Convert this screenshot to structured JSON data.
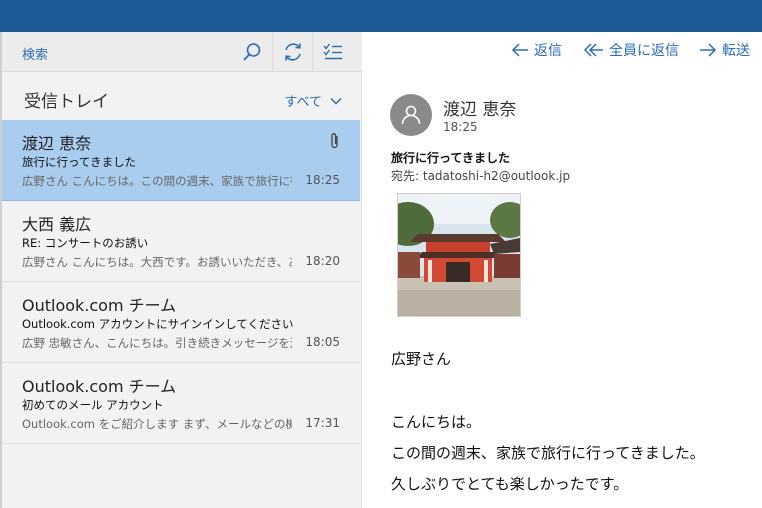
{
  "search": {
    "label": "検索"
  },
  "folder": {
    "name": "受信トレイ",
    "filter": "すべて"
  },
  "messages": [
    {
      "sender": "渡辺 恵奈",
      "subject": "旅行に行ってきました",
      "preview": "広野さん こんにちは。この間の週末、家族で旅行に行ってきました。",
      "time": "18:25"
    },
    {
      "sender": "大西 義広",
      "subject": "RE: コンサートのお誘い",
      "preview": "広野さん こんにちは。大西です。お誘いいただき、ありがとうございます。",
      "time": "18:20"
    },
    {
      "sender": "Outlook.com チーム",
      "subject": "Outlook.com アカウントにサインインしてください",
      "preview": "広野 忠敏さん、こんにちは。引き続きメッセージを送信するには",
      "time": "18:05"
    },
    {
      "sender": "Outlook.com チーム",
      "subject": "初めてのメール アカウント",
      "preview": "Outlook.com をご紹介します まず、メールなどの機能をご覧ください",
      "time": "17:31"
    }
  ],
  "actions": {
    "reply": "返信",
    "reply_all": "全員に返信",
    "forward": "転送"
  },
  "reading": {
    "from": "渡辺 恵奈",
    "time": "18:25",
    "subject": "旅行に行ってきました",
    "to": "宛先: tadatoshi-h2@outlook.jp",
    "body": [
      "広野さん",
      "こんにちは。",
      "この間の週末、家族で旅行に行ってきました。",
      "久しぶりでとても楽しかったです。"
    ]
  },
  "colors": {
    "titlebar": "#1c5a96",
    "accent": "#2a6cb6",
    "selected": "#a9cdee"
  }
}
